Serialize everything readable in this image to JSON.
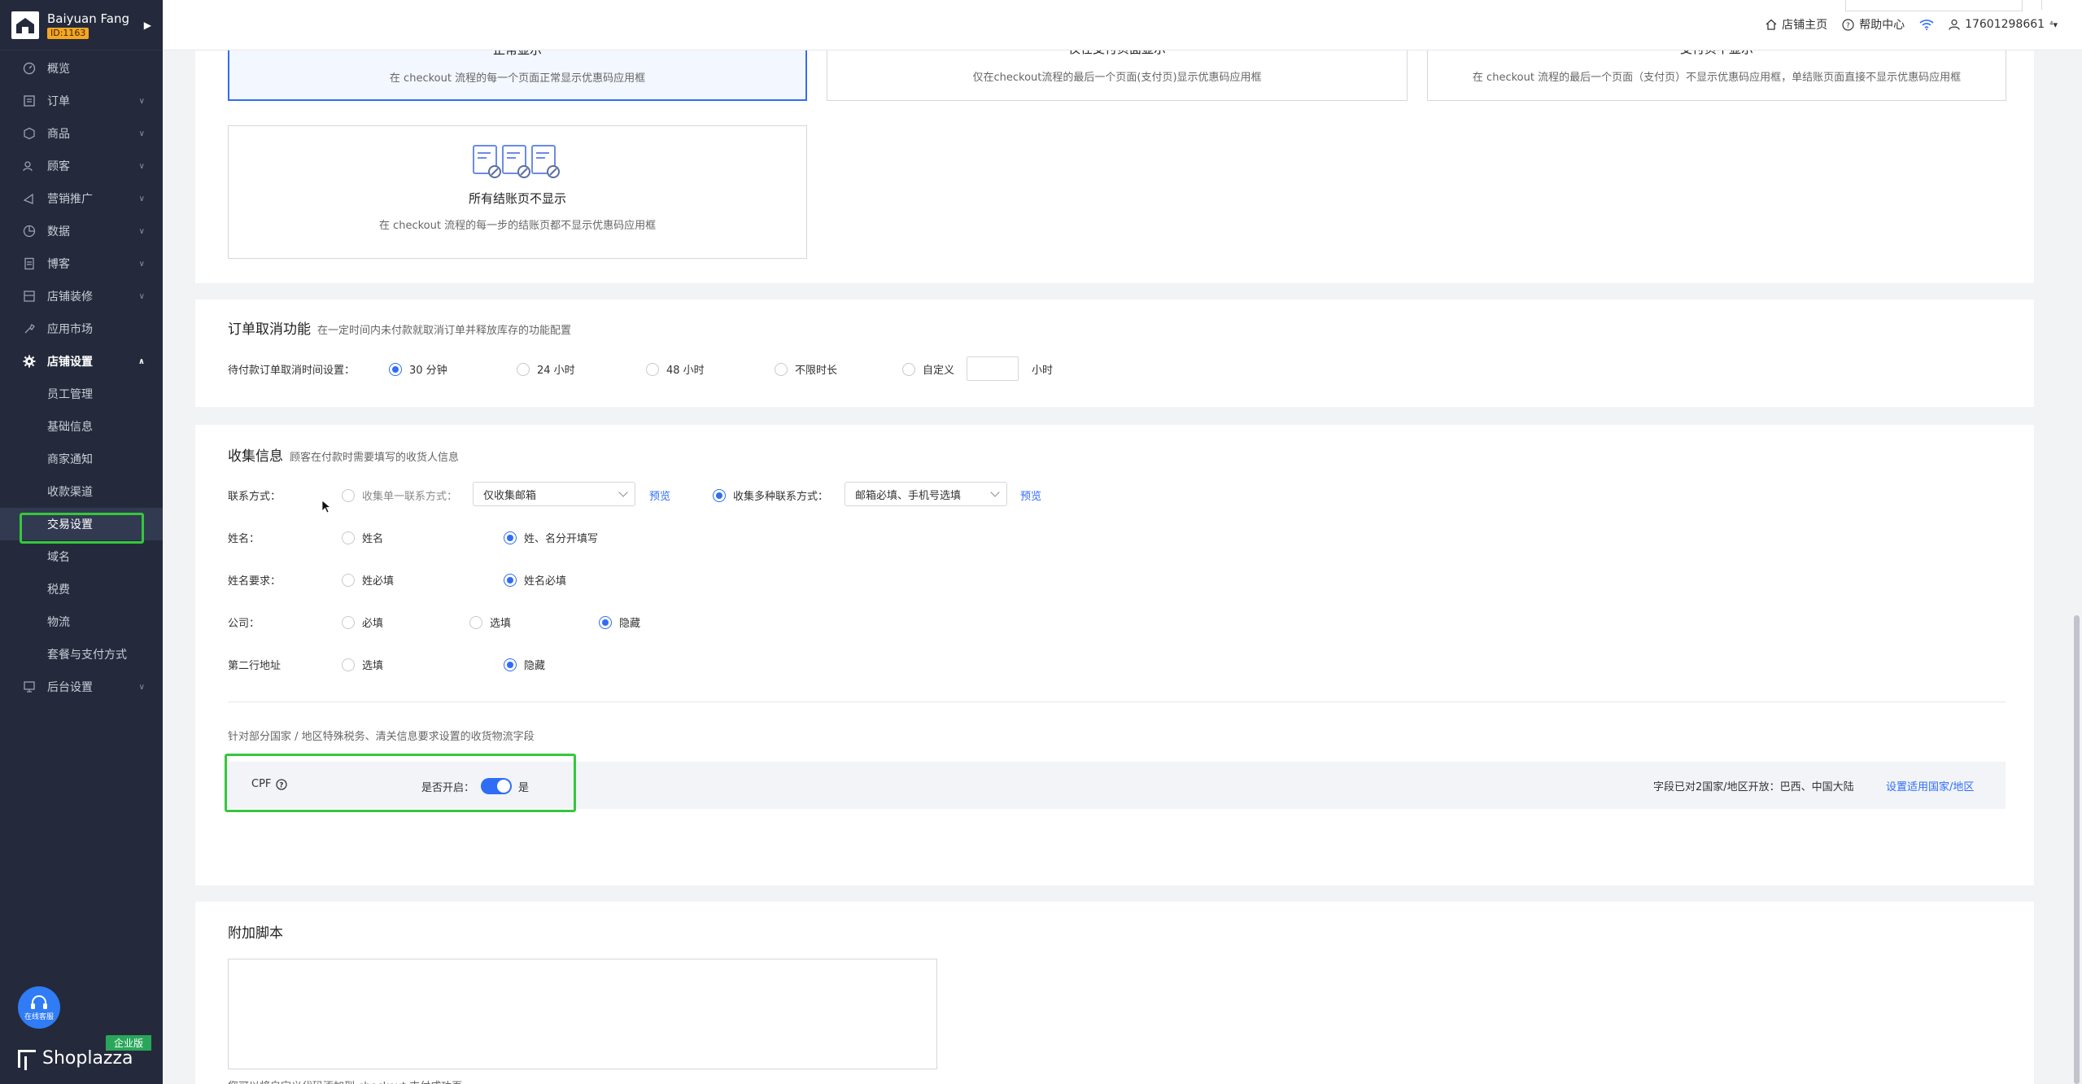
{
  "store": {
    "name": "Baiyuan Fang",
    "id": "ID:1163"
  },
  "sidebar": {
    "items": [
      {
        "label": "概览",
        "icon": "dashboard-icon"
      },
      {
        "label": "订单",
        "icon": "order-icon",
        "chevron": "∨"
      },
      {
        "label": "商品",
        "icon": "product-icon",
        "chevron": "∨"
      },
      {
        "label": "顾客",
        "icon": "customer-icon",
        "chevron": "∨"
      },
      {
        "label": "营销推广",
        "icon": "marketing-icon",
        "chevron": "∨"
      },
      {
        "label": "数据",
        "icon": "data-icon",
        "chevron": "∨"
      },
      {
        "label": "博客",
        "icon": "blog-icon",
        "chevron": "∨"
      },
      {
        "label": "店铺装修",
        "icon": "theme-icon",
        "chevron": "∨"
      },
      {
        "label": "应用市场",
        "icon": "apps-icon"
      },
      {
        "label": "店铺设置",
        "icon": "settings-icon",
        "chevron": "∧"
      }
    ],
    "sub_items": [
      "员工管理",
      "基础信息",
      "商家通知",
      "收款渠道",
      "交易设置",
      "域名",
      "税费",
      "物流",
      "套餐与支付方式"
    ],
    "after_items": [
      {
        "label": "后台设置",
        "icon": "admin-icon",
        "chevron": "∨"
      }
    ],
    "support_label": "在线客服",
    "edition": "企业版",
    "brand": "Shoplazza"
  },
  "topbar": {
    "store_home": "店铺主页",
    "help": "帮助中心",
    "account": "17601298661",
    "account_caret": "⁴▾"
  },
  "coupon_display": {
    "options": [
      {
        "title": "正常显示",
        "desc": "在 checkout 流程的每一个页面正常显示优惠码应用框",
        "selected": true
      },
      {
        "title": "仅在支付页面显示",
        "desc": "仅在checkout流程的最后一个页面(支付页)显示优惠码应用框",
        "selected": false
      },
      {
        "title": "支付页不显示",
        "desc": "在 checkout 流程的最后一个页面（支付页）不显示优惠码应用框，单结账页面直接不显示优惠码应用框",
        "selected": false
      },
      {
        "title": "所有结账页不显示",
        "desc": "在 checkout 流程的每一步的结账页都不显示优惠码应用框",
        "selected": false
      }
    ]
  },
  "cancel_section": {
    "title": "订单取消功能",
    "desc": "在一定时间内未付款就取消订单并释放库存的功能配置",
    "label": "待付款订单取消时间设置：",
    "options": [
      "30 分钟",
      "24 小时",
      "48 小时",
      "不限时长",
      "自定义"
    ],
    "selected_index": 0,
    "unit": "小时"
  },
  "collect_section": {
    "title": "收集信息",
    "desc": "顾客在付款时需要填写的收货人信息",
    "contact": {
      "label": "联系方式：",
      "single_label": "收集单一联系方式：",
      "single_value": "仅收集邮箱",
      "preview": "预览",
      "multi_label": "收集多种联系方式：",
      "multi_value": "邮箱必填、手机号选填"
    },
    "name": {
      "label": "姓名：",
      "options": [
        "姓名",
        "姓、名分开填写"
      ],
      "selected_index": 1
    },
    "name_required": {
      "label": "姓名要求：",
      "options": [
        "姓必填",
        "姓名必填"
      ],
      "selected_index": 1
    },
    "company": {
      "label": "公司：",
      "options": [
        "必填",
        "选填",
        "隐藏"
      ],
      "selected_index": 2
    },
    "address2": {
      "label": "第二行地址",
      "options": [
        "选填",
        "隐藏"
      ],
      "selected_index": 1
    },
    "special_note": "针对部分国家 / 地区特殊税务、清关信息要求设置的收货物流字段",
    "cpf": {
      "label": "CPF",
      "enabled_label": "是否开启：",
      "enabled_value": "是",
      "countries_text": "字段已对2国家/地区开放：巴西、中国大陆",
      "set_link": "设置适用国家/地区"
    }
  },
  "script_section": {
    "title": "附加脚本",
    "hint": "您可以将自定义代码添加到 checkout 支付成功页"
  },
  "colors": {
    "accent": "#2f6df6",
    "sidebar_bg": "#242a3b",
    "highlight": "#35c73c"
  }
}
